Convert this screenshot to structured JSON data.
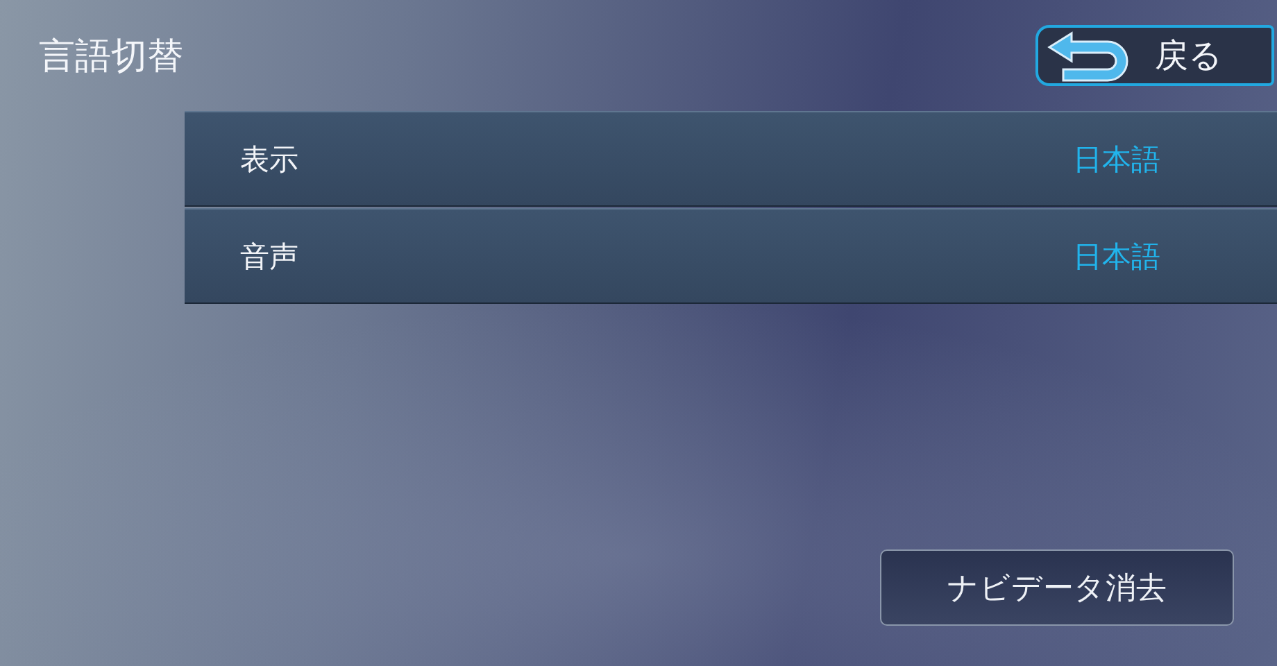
{
  "title": "言語切替",
  "back_button": {
    "label": "戻る"
  },
  "settings": [
    {
      "label": "表示",
      "value": "日本語"
    },
    {
      "label": "音声",
      "value": "日本語"
    }
  ],
  "clear_button": {
    "label": "ナビデータ消去"
  }
}
